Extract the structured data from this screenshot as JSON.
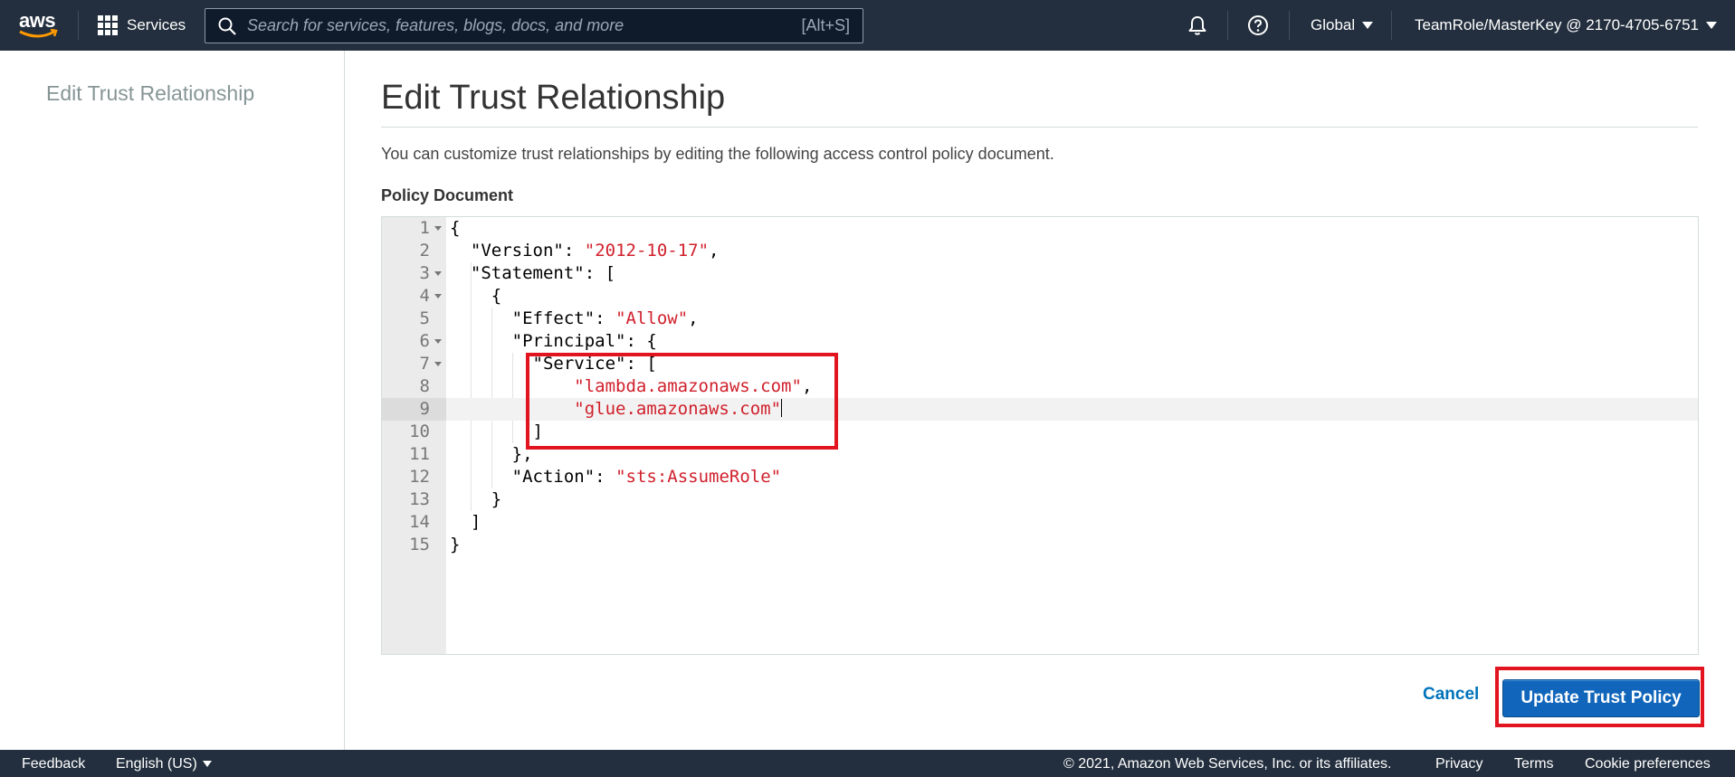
{
  "topnav": {
    "logo_text": "aws",
    "services_label": "Services",
    "search_placeholder": "Search for services, features, blogs, docs, and more",
    "search_shortcut": "[Alt+S]",
    "region_label": "Global",
    "account_label": "TeamRole/MasterKey @ 2170-4705-6751",
    "icons": [
      "bell-icon",
      "help-icon"
    ]
  },
  "sidebar": {
    "title": "Edit Trust Relationship"
  },
  "main": {
    "title": "Edit Trust Relationship",
    "description": "You can customize trust relationships by editing the following access control policy document.",
    "section_label": "Policy Document"
  },
  "editor": {
    "active_line": 9,
    "lines": [
      {
        "n": "1",
        "text": "{"
      },
      {
        "n": "2",
        "text": "  \"Version\": \"2012-10-17\","
      },
      {
        "n": "3",
        "text": "  \"Statement\": ["
      },
      {
        "n": "4",
        "text": "    {"
      },
      {
        "n": "5",
        "text": "      \"Effect\": \"Allow\","
      },
      {
        "n": "6",
        "text": "      \"Principal\": {"
      },
      {
        "n": "7",
        "text": "        \"Service\": ["
      },
      {
        "n": "8",
        "text": "            \"lambda.amazonaws.com\","
      },
      {
        "n": "9",
        "text": "            \"glue.amazonaws.com\""
      },
      {
        "n": "10",
        "text": "        ]"
      },
      {
        "n": "11",
        "text": "      },"
      },
      {
        "n": "12",
        "text": "      \"Action\": \"sts:AssumeRole\""
      },
      {
        "n": "13",
        "text": "    }"
      },
      {
        "n": "14",
        "text": "  ]"
      },
      {
        "n": "15",
        "text": "}"
      }
    ]
  },
  "actions": {
    "cancel_label": "Cancel",
    "submit_label": "Update Trust Policy"
  },
  "footer": {
    "feedback": "Feedback",
    "language": "English (US)",
    "copyright": "© 2021, Amazon Web Services, Inc. or its affiliates.",
    "privacy": "Privacy",
    "terms": "Terms",
    "cookies": "Cookie preferences"
  },
  "colors": {
    "nav_bg": "#232f3e",
    "primary": "#1166bb",
    "link": "#0073bb",
    "string": "#d0202c",
    "annotation": "#e1141f"
  }
}
